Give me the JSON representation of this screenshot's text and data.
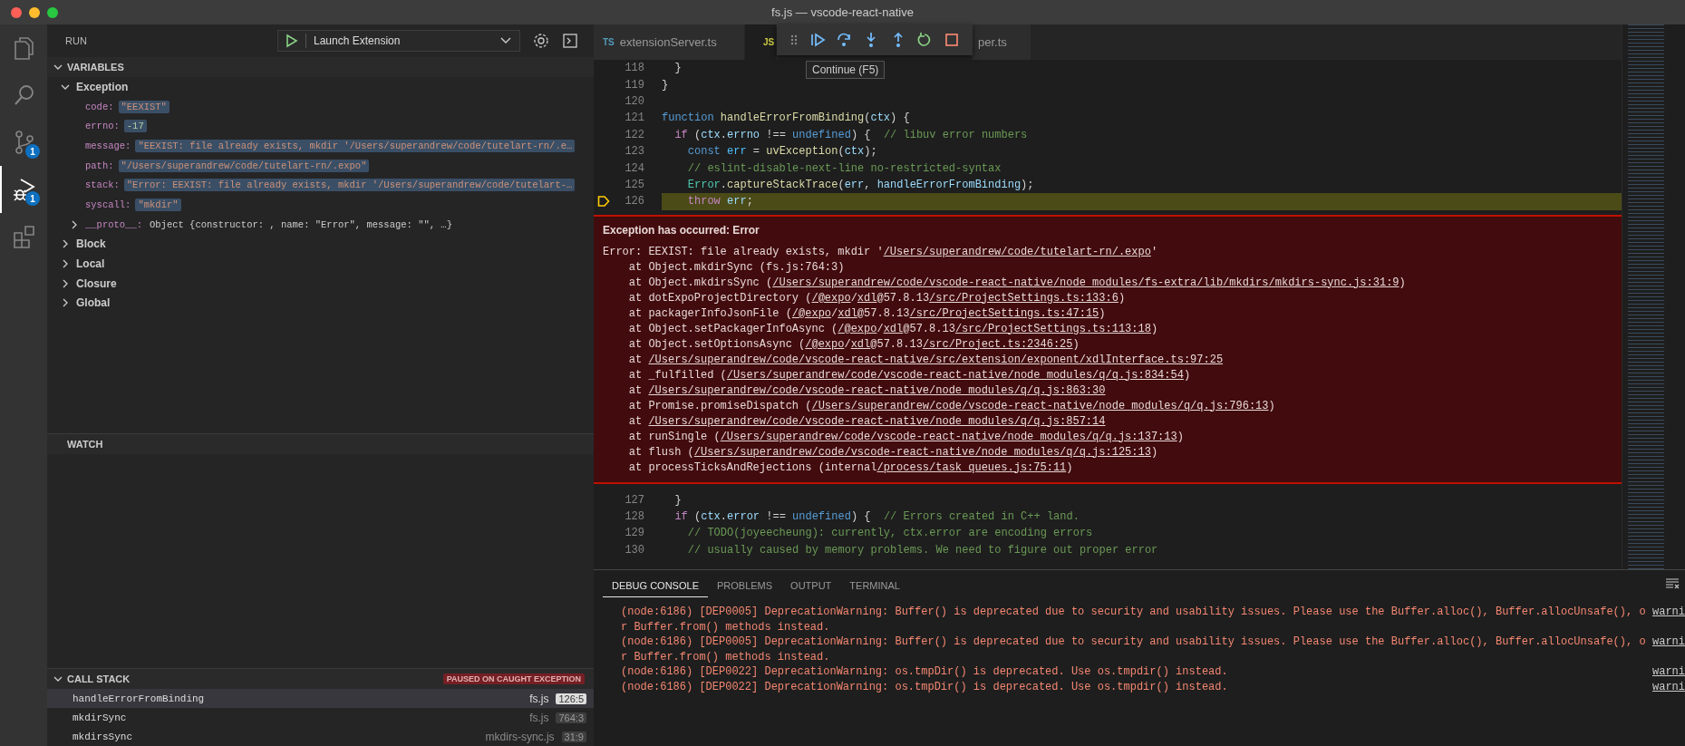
{
  "window": {
    "title": "fs.js — vscode-react-native"
  },
  "activity_bar": [
    {
      "kind": "files",
      "selected": false
    },
    {
      "kind": "search",
      "selected": false
    },
    {
      "kind": "source-control",
      "selected": false,
      "badge": "1"
    },
    {
      "kind": "debug",
      "selected": true,
      "badge": "1"
    },
    {
      "kind": "extensions",
      "selected": false
    }
  ],
  "run_header": {
    "title": "RUN",
    "configuration": "Launch Extension"
  },
  "variables": {
    "title": "VARIABLES",
    "expanded": true,
    "scopes": [
      {
        "name": "Exception",
        "expanded": true,
        "children": [
          {
            "name": "code:",
            "value": "\"EEXIST\"",
            "kind": "string",
            "changed": true
          },
          {
            "name": "errno:",
            "value": "-17",
            "kind": "number",
            "changed": true
          },
          {
            "name": "message:",
            "value": "\"EEXIST: file already exists, mkdir '/Users/superandrew/code/tutelart-rn/.e…",
            "kind": "string",
            "changed": true
          },
          {
            "name": "path:",
            "value": "\"/Users/superandrew/code/tutelart-rn/.expo\"",
            "kind": "string",
            "changed": true
          },
          {
            "name": "stack:",
            "value": "\"Error: EEXIST: file already exists, mkdir '/Users/superandrew/code/tutelart-…",
            "kind": "string",
            "changed": true
          },
          {
            "name": "syscall:",
            "value": "\"mkdir\"",
            "kind": "string",
            "changed": true
          },
          {
            "name": "__proto__:",
            "value": "Object {constructor: , name: \"Error\", message: \"\", …}",
            "kind": "object",
            "changed": false,
            "expanded": false
          }
        ]
      },
      {
        "name": "Block",
        "expanded": false
      },
      {
        "name": "Local",
        "expanded": false
      },
      {
        "name": "Closure",
        "expanded": false
      },
      {
        "name": "Global",
        "expanded": false
      }
    ]
  },
  "watch": {
    "title": "WATCH"
  },
  "call_stack": {
    "title": "CALL STACK",
    "expanded": true,
    "status": "PAUSED ON CAUGHT EXCEPTION",
    "frames": [
      {
        "name": "handleErrorFromBinding",
        "file": "fs.js",
        "position": "126:5",
        "selected": true
      },
      {
        "name": "mkdirSync",
        "file": "fs.js",
        "position": "764:3",
        "selected": false
      },
      {
        "name": "mkdirsSync",
        "file": "mkdirs-sync.js",
        "position": "31:9",
        "selected": false
      }
    ]
  },
  "tabs": [
    {
      "icon": "TS",
      "label": "extensionServer.ts",
      "selected": false
    },
    {
      "icon": "JS",
      "selected": true
    },
    {
      "label": "per.ts",
      "selected": false
    }
  ],
  "debug_toolbar": {
    "tooltip": "Continue (F5)"
  },
  "code_lines": [
    {
      "number": "118",
      "current": false,
      "tokens": [
        {
          "t": "  }",
          "kind": "plain"
        }
      ]
    },
    {
      "number": "119",
      "current": false,
      "tokens": [
        {
          "t": "}",
          "kind": "plain"
        }
      ]
    },
    {
      "number": "120",
      "current": false
    },
    {
      "number": "121",
      "current": false,
      "tokens": [
        {
          "t": "function",
          "kind": "storage"
        },
        {
          "t": " handleErrorFromBinding",
          "kind": "function"
        },
        {
          "t": "(",
          "kind": "plain"
        },
        {
          "t": "ctx",
          "kind": "variable"
        },
        {
          "t": ") {",
          "kind": "plain"
        }
      ]
    },
    {
      "number": "122",
      "current": false,
      "tokens": [
        {
          "t": "  if",
          "kind": "keyword"
        },
        {
          "t": " (",
          "kind": "plain"
        },
        {
          "t": "ctx",
          "kind": "variable"
        },
        {
          "t": ".",
          "kind": "plain"
        },
        {
          "t": "errno",
          "kind": "variable"
        },
        {
          "t": " !==",
          "kind": "plain"
        },
        {
          "t": " undefined",
          "kind": "storage"
        },
        {
          "t": ") {",
          "kind": "plain"
        },
        {
          "t": "  // libuv error numbers",
          "kind": "comment"
        }
      ]
    },
    {
      "number": "123",
      "current": false,
      "tokens": [
        {
          "t": "    const",
          "kind": "storage"
        },
        {
          "t": " err",
          "kind": "constant"
        },
        {
          "t": " =",
          "kind": "plain"
        },
        {
          "t": " uvException",
          "kind": "function"
        },
        {
          "t": "(",
          "kind": "plain"
        },
        {
          "t": "ctx",
          "kind": "variable"
        },
        {
          "t": ");",
          "kind": "plain"
        }
      ]
    },
    {
      "number": "124",
      "current": false,
      "tokens": [
        {
          "t": "    // eslint-disable-next-line no-restricted-syntax",
          "kind": "comment"
        }
      ]
    },
    {
      "number": "125",
      "current": false,
      "tokens": [
        {
          "t": "    Error",
          "kind": "type"
        },
        {
          "t": ".",
          "kind": "plain"
        },
        {
          "t": "captureStackTrace",
          "kind": "function"
        },
        {
          "t": "(",
          "kind": "plain"
        },
        {
          "t": "err",
          "kind": "variable"
        },
        {
          "t": ",",
          "kind": "plain"
        },
        {
          "t": " handleErrorFromBinding",
          "kind": "variable"
        },
        {
          "t": ");",
          "kind": "plain"
        }
      ]
    },
    {
      "number": "126",
      "current": true,
      "tokens": [
        {
          "t": "    throw",
          "kind": "keyword"
        },
        {
          "t": " err",
          "kind": "variable"
        },
        {
          "t": ";",
          "kind": "plain"
        }
      ]
    }
  ],
  "exception": {
    "title": "Exception has occurred: Error",
    "message": [
      {
        "t": "Error: EEXIST: file already exists, mkdir '",
        "link": false
      },
      {
        "t": "/Users/superandrew/code/tutelart-rn/.expo",
        "link": true
      },
      {
        "t": "'",
        "link": false
      }
    ],
    "stack": [
      [
        {
          "t": "at Object.mkdirSync (fs.js:764:3)",
          "link": false
        }
      ],
      [
        {
          "t": "at Object.mkdirsSync (",
          "link": false
        },
        {
          "t": "/Users/superandrew/code/vscode-react-native/node_modules/fs-extra/lib/mkdirs/mkdirs-sync.js:31:9",
          "link": true
        },
        {
          "t": ")",
          "link": false
        }
      ],
      [
        {
          "t": "at dotExpoProjectDirectory (",
          "link": false
        },
        {
          "t": "/@expo",
          "link": true
        },
        {
          "t": "/",
          "link": false
        },
        {
          "t": "xdl",
          "link": true
        },
        {
          "t": "@57.8.13",
          "link": false
        },
        {
          "t": "/src/ProjectSettings.ts:133:6",
          "link": true
        },
        {
          "t": ")",
          "link": false
        }
      ],
      [
        {
          "t": "at packagerInfoJsonFile (",
          "link": false
        },
        {
          "t": "/@expo",
          "link": true
        },
        {
          "t": "/",
          "link": false
        },
        {
          "t": "xdl",
          "link": true
        },
        {
          "t": "@57.8.13",
          "link": false
        },
        {
          "t": "/src/ProjectSettings.ts:47:15",
          "link": true
        },
        {
          "t": ")",
          "link": false
        }
      ],
      [
        {
          "t": "at Object.setPackagerInfoAsync (",
          "link": false
        },
        {
          "t": "/@expo",
          "link": true
        },
        {
          "t": "/",
          "link": false
        },
        {
          "t": "xdl",
          "link": true
        },
        {
          "t": "@57.8.13",
          "link": false
        },
        {
          "t": "/src/ProjectSettings.ts:113:18",
          "link": true
        },
        {
          "t": ")",
          "link": false
        }
      ],
      [
        {
          "t": "at Object.setOptionsAsync (",
          "link": false
        },
        {
          "t": "/@expo",
          "link": true
        },
        {
          "t": "/",
          "link": false
        },
        {
          "t": "xdl",
          "link": true
        },
        {
          "t": "@57.8.13",
          "link": false
        },
        {
          "t": "/src/Project.ts:2346:25",
          "link": true
        },
        {
          "t": ")",
          "link": false
        }
      ],
      [
        {
          "t": "at",
          "link": false
        },
        {
          "t": "/Users/superandrew/code/vscode-react-native/src/extension/exponent/xdlInterface.ts:97:25",
          "link": true
        }
      ],
      [
        {
          "t": "at _fulfilled (",
          "link": false
        },
        {
          "t": "/Users/superandrew/code/vscode-react-native/node_modules/q/q.js:834:54",
          "link": true
        },
        {
          "t": ")",
          "link": false
        }
      ],
      [
        {
          "t": "at",
          "link": false
        },
        {
          "t": "/Users/superandrew/code/vscode-react-native/node_modules/q/q.js:863:30",
          "link": true
        }
      ],
      [
        {
          "t": "at Promise.promiseDispatch (",
          "link": false
        },
        {
          "t": "/Users/superandrew/code/vscode-react-native/node_modules/q/q.js:796:13",
          "link": true
        },
        {
          "t": ")",
          "link": false
        }
      ],
      [
        {
          "t": "at",
          "link": false
        },
        {
          "t": "/Users/superandrew/code/vscode-react-native/node_modules/q/q.js:857:14",
          "link": true
        }
      ],
      [
        {
          "t": "at runSingle (",
          "link": false
        },
        {
          "t": "/Users/superandrew/code/vscode-react-native/node_modules/q/q.js:137:13",
          "link": true
        },
        {
          "t": ")",
          "link": false
        }
      ],
      [
        {
          "t": "at flush (",
          "link": false
        },
        {
          "t": "/Users/superandrew/code/vscode-react-native/node_modules/q/q.js:125:13",
          "link": true
        },
        {
          "t": ")",
          "link": false
        }
      ],
      [
        {
          "t": "at processTicksAndRejections (internal",
          "link": false
        },
        {
          "t": "/process/task_queues.js:75:11",
          "link": true
        },
        {
          "t": ")",
          "link": false
        }
      ]
    ]
  },
  "code_lines_after": [
    {
      "number": "127",
      "current": false,
      "tokens": [
        {
          "t": "  }",
          "kind": "plain"
        }
      ]
    },
    {
      "number": "128",
      "current": false,
      "tokens": [
        {
          "t": "  if",
          "kind": "keyword"
        },
        {
          "t": " (",
          "kind": "plain"
        },
        {
          "t": "ctx",
          "kind": "variable"
        },
        {
          "t": ".",
          "kind": "plain"
        },
        {
          "t": "error",
          "kind": "variable"
        },
        {
          "t": " !==",
          "kind": "plain"
        },
        {
          "t": " undefined",
          "kind": "storage"
        },
        {
          "t": ") {",
          "kind": "plain"
        },
        {
          "t": "  // Errors created in C++ land.",
          "kind": "comment"
        }
      ]
    },
    {
      "number": "129",
      "current": false,
      "tokens": [
        {
          "t": "    // TODO(joyeecheung): currently, ctx.error are encoding errors",
          "kind": "comment"
        }
      ]
    },
    {
      "number": "130",
      "current": false,
      "tokens": [
        {
          "t": "    // usually caused by memory problems. We need to figure out proper error",
          "kind": "comment"
        }
      ]
    }
  ],
  "panel": {
    "tabs": [
      {
        "label": "DEBUG CONSOLE",
        "selected": true
      },
      {
        "label": "PROBLEMS",
        "selected": false
      },
      {
        "label": "OUTPUT",
        "selected": false
      },
      {
        "label": "TERMINAL",
        "selected": false
      }
    ],
    "console": [
      {
        "text": "(node:6186) [DEP0005] DeprecationWarning: Buffer() is deprecated due to security and usability issues. Please use the Buffer.alloc(), Buffer.allocUnsafe(), or Buffer.from() methods instead.",
        "source": "warni"
      },
      {
        "text": "(node:6186) [DEP0005] DeprecationWarning: Buffer() is deprecated due to security and usability issues. Please use the Buffer.alloc(), Buffer.allocUnsafe(), or Buffer.from() methods instead.",
        "source": "warni"
      },
      {
        "text": "(node:6186) [DEP0022] DeprecationWarning: os.tmpDir() is deprecated. Use os.tmpdir() instead.",
        "source": "warni"
      },
      {
        "text": "(node:6186) [DEP0022] DeprecationWarning: os.tmpDir() is deprecated. Use os.tmpdir() instead.",
        "source": "warni"
      }
    ]
  }
}
